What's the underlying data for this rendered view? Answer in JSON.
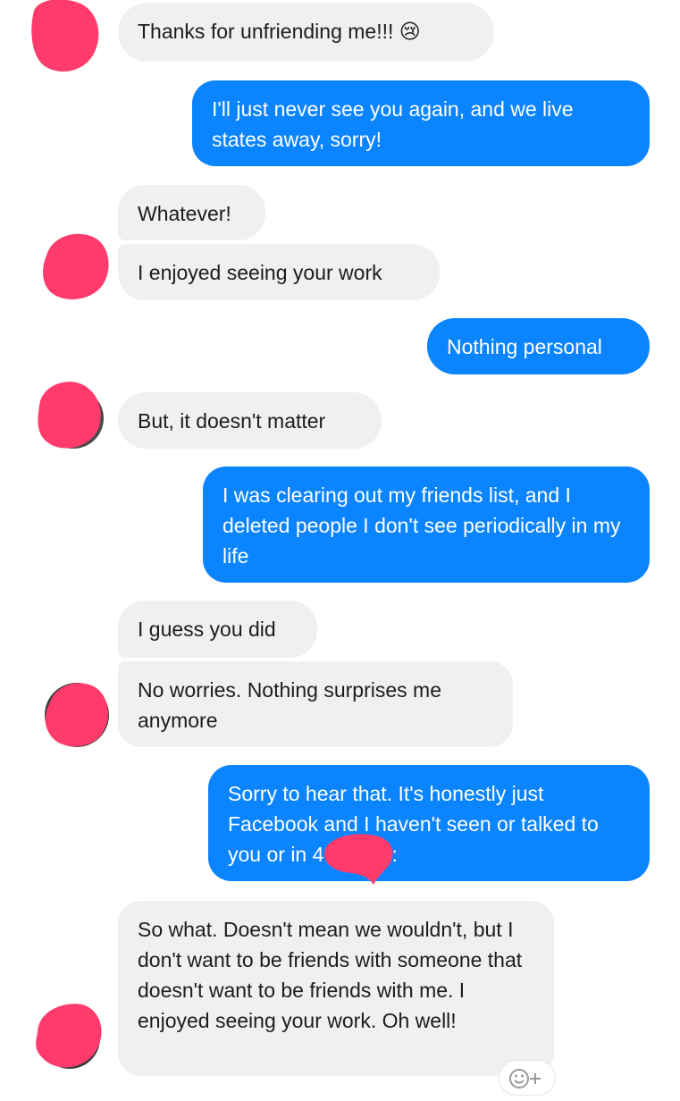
{
  "conversation": {
    "messages": [
      {
        "from": "them",
        "text": "Thanks for unfriending me!!! 😢"
      },
      {
        "from": "me",
        "text": "I'll just never see you again, and we live states away, sorry!"
      },
      {
        "from": "them",
        "text": "Whatever!"
      },
      {
        "from": "them",
        "text": "I enjoyed seeing your work"
      },
      {
        "from": "me",
        "text": "Nothing personal"
      },
      {
        "from": "them",
        "text": "But, it doesn't matter"
      },
      {
        "from": "me",
        "text": "I was clearing out my friends list, and I deleted people I don't see periodically in my life"
      },
      {
        "from": "them",
        "text": "I guess you did"
      },
      {
        "from": "them",
        "text": "No worries. Nothing surprises me anymore"
      },
      {
        "from": "me",
        "text": "Sorry to hear that. It's honestly just Facebook and I haven't seen or talked to you or       in 4+ years:"
      },
      {
        "from": "them",
        "text": "So what. Doesn't mean we wouldn't, but I don't want to be friends with someone that doesn't want to be friends with me. I enjoyed seeing your work. Oh well!"
      }
    ]
  },
  "colors": {
    "incoming_bubble": "#f0f0f0",
    "outgoing_bubble": "#0a84ff",
    "redaction": "#ff3b6b"
  },
  "icons": {
    "avatar": "avatar-redacted-icon",
    "reaction": "add-reaction-icon"
  }
}
